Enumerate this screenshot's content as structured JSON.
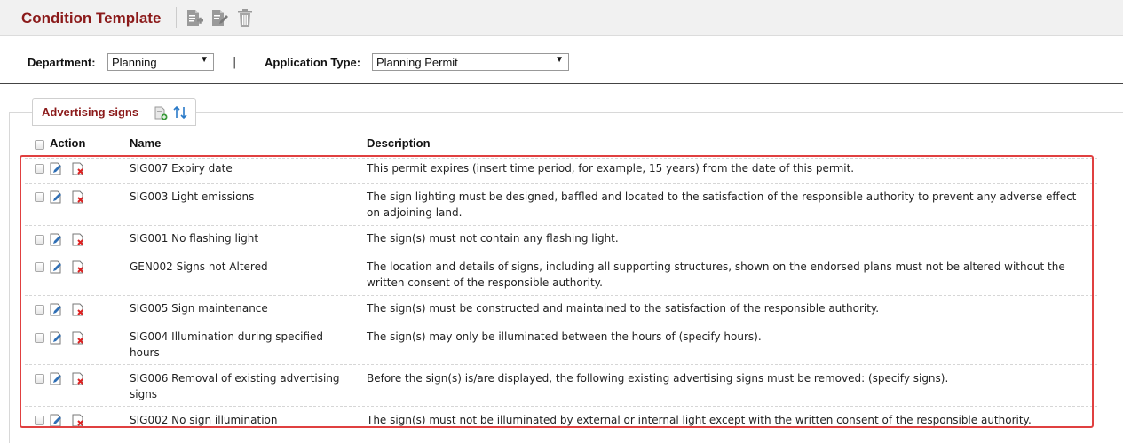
{
  "header": {
    "title": "Condition Template",
    "icons": [
      "add-document-icon",
      "edit-document-icon",
      "trash-icon"
    ]
  },
  "filters": {
    "department_label": "Department:",
    "department_value": "Planning",
    "separator": "|",
    "application_type_label": "Application Type:",
    "application_type_value": "Planning Permit"
  },
  "tab": {
    "label": "Advertising signs",
    "icons": [
      "add-condition-icon",
      "sort-icon"
    ]
  },
  "table": {
    "columns": {
      "action": "Action",
      "name": "Name",
      "description": "Description"
    },
    "rows": [
      {
        "name": "SIG007 Expiry date",
        "description": "This permit expires (insert time period, for example, 15 years) from the date of this permit."
      },
      {
        "name": "SIG003 Light emissions",
        "description": "The sign lighting must be designed, baffled and located to the satisfaction of the responsible authority to prevent any adverse effect on adjoining land."
      },
      {
        "name": "SIG001 No flashing light",
        "description": "The sign(s) must not contain any flashing light."
      },
      {
        "name": "GEN002 Signs not Altered",
        "description": "The location and details of signs, including all supporting structures, shown on the endorsed plans must not be altered without the written consent of the responsible authority."
      },
      {
        "name": "SIG005 Sign maintenance",
        "description": "The sign(s) must be constructed and maintained to the satisfaction of the responsible authority."
      },
      {
        "name": "SIG004 Illumination during specified hours",
        "description": "The sign(s) may only be illuminated between the hours of (specify hours)."
      },
      {
        "name": "SIG006 Removal of existing advertising signs",
        "description": "Before the sign(s) is/are displayed, the following existing advertising signs must be removed: (specify signs)."
      },
      {
        "name": "SIG002 No sign illumination",
        "description": "The sign(s) must not be illuminated by external or internal light except with the written consent of the responsible authority."
      }
    ]
  },
  "colors": {
    "accent": "#8b1a1a",
    "highlight": "#e04040"
  }
}
